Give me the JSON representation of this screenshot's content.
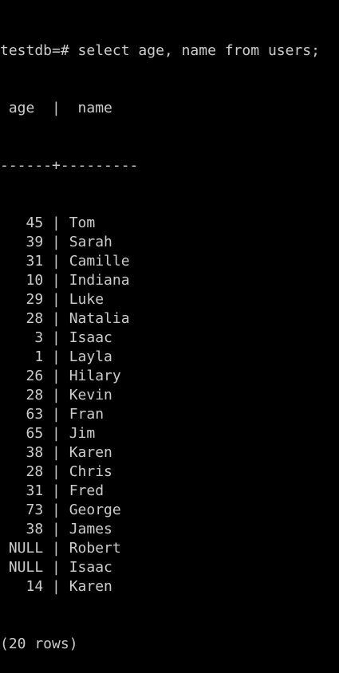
{
  "terminal": {
    "command_line": "testdb=# select age, name from users;",
    "header": " age  |  name",
    "separator": "------+---------",
    "rows": [
      {
        "age": "45",
        "name": "Tom"
      },
      {
        "age": "39",
        "name": "Sarah"
      },
      {
        "age": "31",
        "name": "Camille"
      },
      {
        "age": "10",
        "name": "Indiana"
      },
      {
        "age": "29",
        "name": "Luke"
      },
      {
        "age": "28",
        "name": "Natalia"
      },
      {
        "age": "3",
        "name": "Isaac"
      },
      {
        "age": "1",
        "name": "Layla"
      },
      {
        "age": "26",
        "name": "Hilary"
      },
      {
        "age": "28",
        "name": "Kevin"
      },
      {
        "age": "63",
        "name": "Fran"
      },
      {
        "age": "65",
        "name": "Jim"
      },
      {
        "age": "38",
        "name": "Karen"
      },
      {
        "age": "28",
        "name": "Chris"
      },
      {
        "age": "31",
        "name": "Fred"
      },
      {
        "age": "73",
        "name": "George"
      },
      {
        "age": "38",
        "name": "James"
      },
      {
        "age": "NULL",
        "name": "Robert"
      },
      {
        "age": "NULL",
        "name": "Isaac"
      },
      {
        "age": "14",
        "name": "Karen"
      }
    ],
    "row_count": "(20 rows)",
    "colors": {
      "background": "#000000",
      "text": "#cccccc"
    }
  }
}
